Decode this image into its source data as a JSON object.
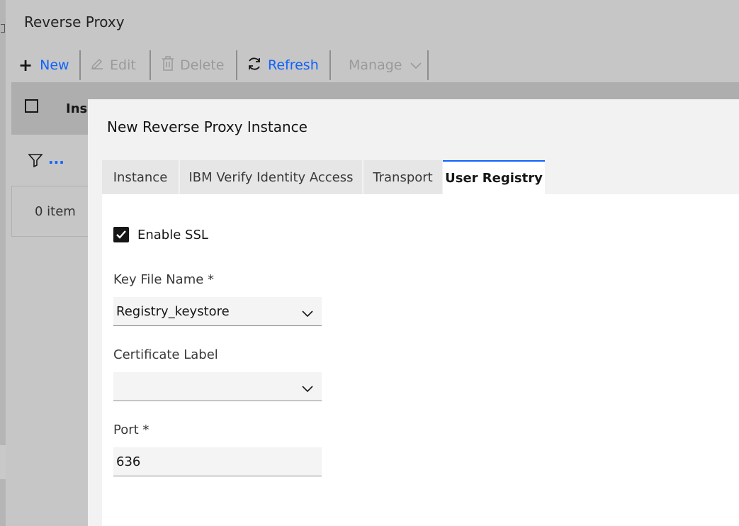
{
  "page": {
    "title": "Reverse Proxy"
  },
  "toolbar": {
    "new": "New",
    "edit": "Edit",
    "delete": "Delete",
    "refresh": "Refresh",
    "manage": "Manage"
  },
  "table": {
    "header_col": "Ins",
    "filter_more": "...",
    "item_count": "0 item"
  },
  "modal": {
    "title": "New Reverse Proxy Instance",
    "tabs": [
      {
        "label": "Instance",
        "active": false
      },
      {
        "label": "IBM Verify Identity Access",
        "active": false
      },
      {
        "label": "Transport",
        "active": false
      },
      {
        "label": "User Registry",
        "active": true
      }
    ],
    "form": {
      "enable_ssl": {
        "label": "Enable SSL",
        "checked": true
      },
      "key_file_name": {
        "label": "Key File Name *",
        "value": "Registry_keystore"
      },
      "certificate_label": {
        "label": "Certificate Label",
        "value": ""
      },
      "port": {
        "label": "Port *",
        "value": "636"
      }
    }
  },
  "colors": {
    "accent": "#0f62fe",
    "overlay": "#c6c6c6",
    "modal_bg": "#f2f2f2"
  }
}
